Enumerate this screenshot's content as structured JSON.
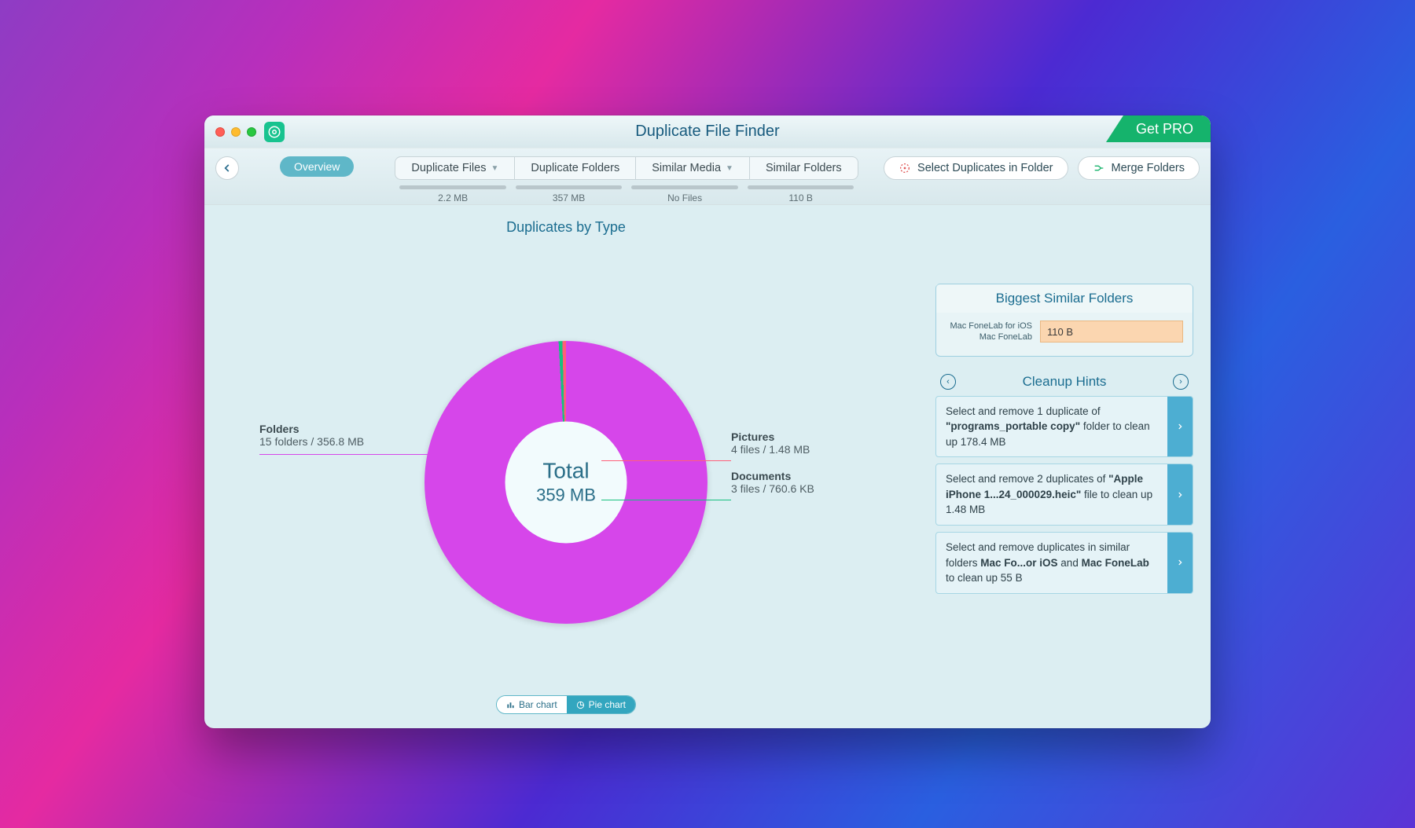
{
  "titlebar": {
    "title": "Duplicate File Finder",
    "get_pro": "Get PRO"
  },
  "toolbar": {
    "overview": "Overview",
    "tabs": [
      {
        "label": "Duplicate Files",
        "has_caret": true,
        "sub": "2.2 MB"
      },
      {
        "label": "Duplicate Folders",
        "has_caret": false,
        "sub": "357 MB"
      },
      {
        "label": "Similar Media",
        "has_caret": true,
        "sub": "No Files"
      },
      {
        "label": "Similar Folders",
        "has_caret": false,
        "sub": "110 B"
      }
    ],
    "select_dups": "Select Duplicates in Folder",
    "merge": "Merge Folders"
  },
  "chart": {
    "title": "Duplicates by Type",
    "center_label": "Total",
    "center_value": "359 MB",
    "left": {
      "label": "Folders",
      "sub": "15 folders / 356.8 MB"
    },
    "r1": {
      "label": "Pictures",
      "sub": "4 files / 1.48 MB"
    },
    "r2": {
      "label": "Documents",
      "sub": "3 files / 760.6 KB"
    },
    "toggle": {
      "bar": "Bar chart",
      "pie": "Pie chart"
    }
  },
  "side": {
    "biggest_title": "Biggest Similar Folders",
    "biggest_label1": "Mac FoneLab for iOS",
    "biggest_label2": "Mac FoneLab",
    "biggest_value": "110 B",
    "hints_title": "Cleanup Hints",
    "hints": [
      {
        "pre": "Select and remove 1 duplicate of ",
        "bold": "\"programs_portable copy\"",
        "post": " folder to clean up 178.4 MB"
      },
      {
        "pre": "Select and remove 2 duplicates of ",
        "bold": "\"Apple iPhone 1...24_000029.heic\"",
        "post": " file to clean up 1.48 MB"
      },
      {
        "pre": "Select and remove duplicates in similar folders ",
        "bold": "Mac Fo...or iOS",
        "mid": " and ",
        "bold2": "Mac FoneLab",
        "post": " to clean up 55 B"
      }
    ]
  },
  "chart_data": {
    "type": "pie",
    "title": "Duplicates by Type",
    "total_label": "Total",
    "total_value_mb": 359,
    "series": [
      {
        "name": "Folders",
        "count": 15,
        "size_mb": 356.8,
        "color": "#d646ea"
      },
      {
        "name": "Pictures",
        "count": 4,
        "size_mb": 1.48,
        "color": "#ff5f7a"
      },
      {
        "name": "Documents",
        "count": 3,
        "size_mb": 0.7606,
        "color": "#17c07f"
      }
    ]
  }
}
